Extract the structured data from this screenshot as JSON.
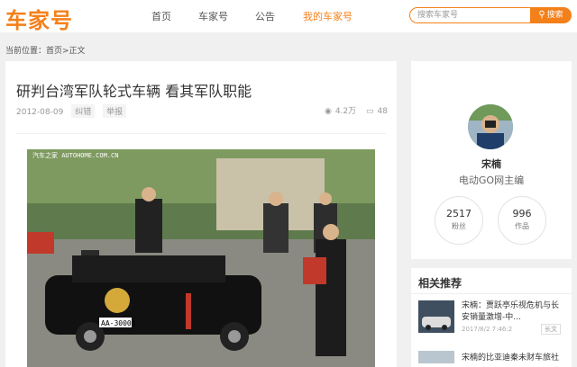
{
  "header": {
    "logo": "车家号",
    "nav": [
      "首页",
      "车家号",
      "公告",
      "我的车家号"
    ],
    "search_placeholder": "搜索车家号",
    "search_button": "搜索"
  },
  "breadcrumb": "当前位置：首页>正文",
  "article": {
    "title": "研判台湾军队轮式车辆 看其军队职能",
    "date": "2012-08-09",
    "tag_correct": "纠错",
    "tag_report": "举报",
    "views": "4.2万",
    "comments": "48",
    "photo_watermark": "汽车之家 AUTOHOME.COM.CN",
    "plate": "AA-30001"
  },
  "author": {
    "name": "宋楠",
    "desc": "电动GO网主编",
    "fans_count": "2517",
    "fans_label": "粉丝",
    "works_count": "996",
    "works_label": "作品"
  },
  "related": {
    "title": "相关推荐",
    "items": [
      {
        "text": "宋楠：贾跃亭乐视危机与长安销量激增-中...",
        "date": "2017/8/2 7:46:2",
        "badge": "长文"
      },
      {
        "text": "宋楠的比亚迪秦未财车旅社"
      }
    ]
  },
  "colors": {
    "accent": "#f4801a"
  }
}
